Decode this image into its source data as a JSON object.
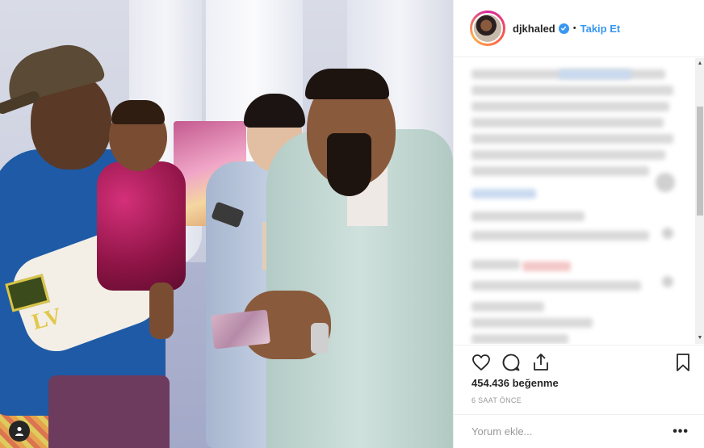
{
  "post": {
    "username": "djkhaled",
    "separator": "•",
    "follow_label": "Takip Et",
    "likes_text": "454.436 beğenme",
    "time_text": "6 SAAT ÖNCE",
    "comment_placeholder": "Yorum ekle...",
    "more_label": "•••"
  },
  "icons": {
    "like": "heart-icon",
    "comment": "comment-bubble-icon",
    "share": "share-icon",
    "save": "bookmark-icon",
    "verified": "verified-badge-icon",
    "user_tag": "user-tag-icon"
  },
  "colors": {
    "accent": "#3897f0",
    "text": "#262626",
    "muted": "#999999",
    "border": "#efefef"
  }
}
